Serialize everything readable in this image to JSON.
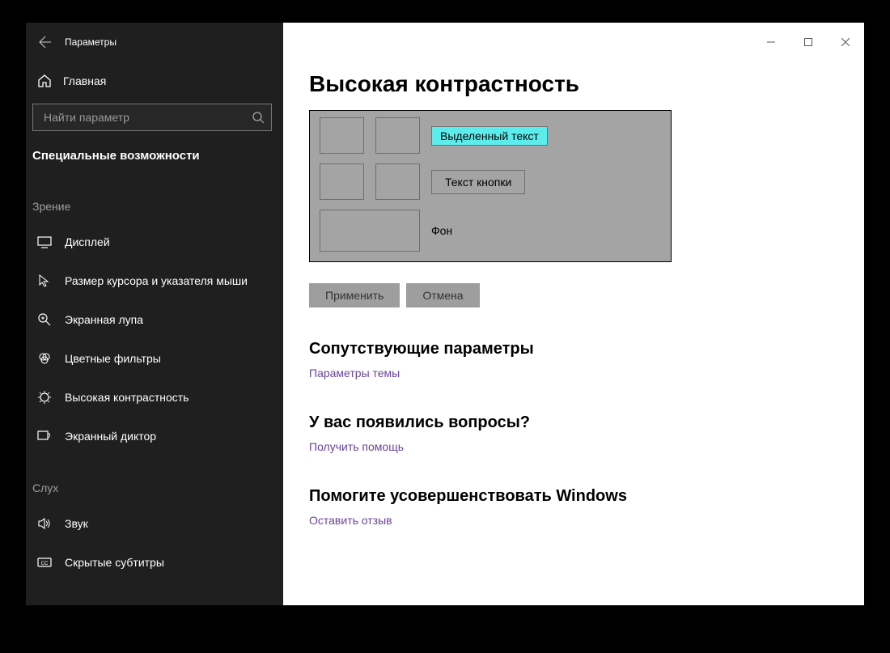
{
  "app_title": "Параметры",
  "home_label": "Главная",
  "search_placeholder": "Найти параметр",
  "category": "Специальные возможности",
  "sections": {
    "vision_title": "Зрение",
    "hearing_title": "Слух"
  },
  "nav": {
    "display": "Дисплей",
    "cursor": "Размер курсора и указателя мыши",
    "magnifier": "Экранная лупа",
    "color_filters": "Цветные фильтры",
    "high_contrast": "Высокая контрастность",
    "narrator": "Экранный диктор",
    "audio": "Звук",
    "captions": "Скрытые субтитры"
  },
  "page": {
    "title": "Высокая контрастность",
    "labels": {
      "selected_text": "Выделенный текст",
      "button_text": "Текст кнопки",
      "background": "Фон"
    },
    "buttons": {
      "apply": "Применить",
      "cancel": "Отмена"
    },
    "related_heading": "Сопутствующие параметры",
    "theme_link": "Параметры темы",
    "questions_heading": "У вас появились вопросы?",
    "help_link": "Получить помощь",
    "improve_heading": "Помогите усовершенствовать Windows",
    "feedback_link": "Оставить отзыв"
  }
}
